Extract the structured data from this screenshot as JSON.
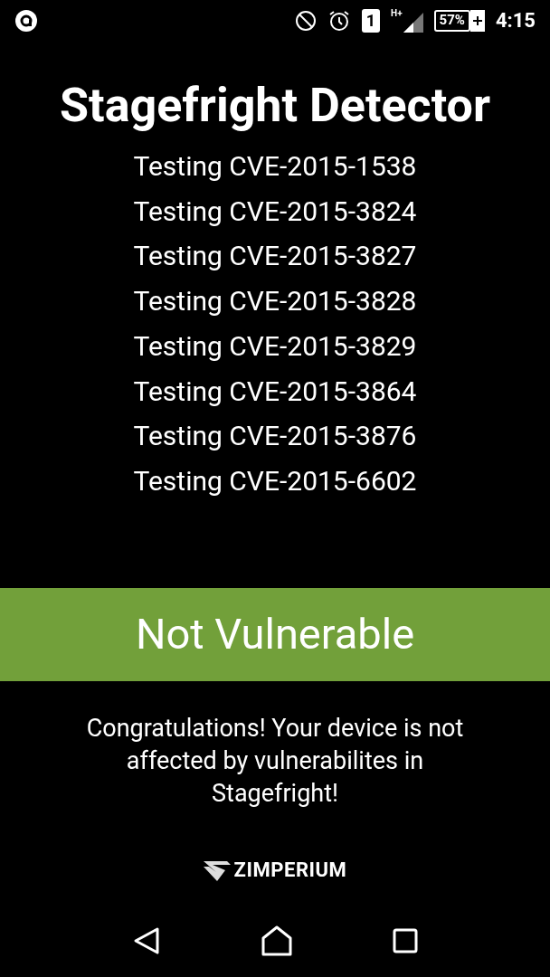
{
  "status_bar": {
    "sim": "1",
    "network": "H+",
    "battery": "57%",
    "time": "4:15"
  },
  "title": "Stagefright Detector",
  "tests": [
    "Testing CVE-2015-1538",
    "Testing CVE-2015-3824",
    "Testing CVE-2015-3827",
    "Testing CVE-2015-3828",
    "Testing CVE-2015-3829",
    "Testing CVE-2015-3864",
    "Testing CVE-2015-3876",
    "Testing CVE-2015-6602"
  ],
  "result": {
    "label": "Not Vulnerable",
    "vulnerable": false
  },
  "message": "Congratulations! Your device is not affected by vulnerabilites in Stagefright!",
  "brand": "ZIMPERIUM"
}
